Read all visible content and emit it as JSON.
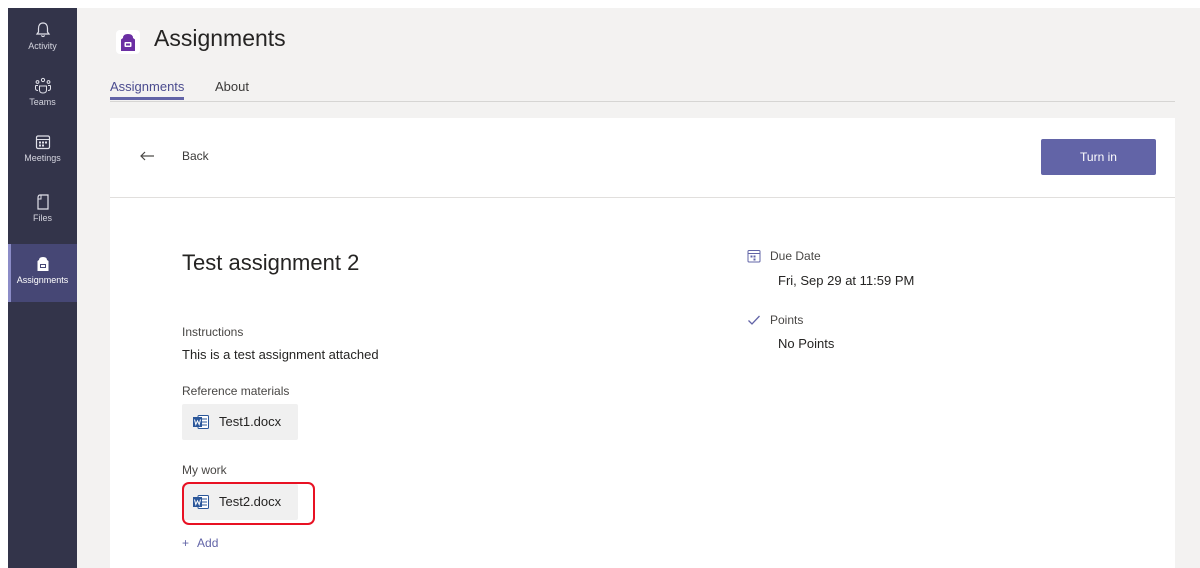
{
  "rail": {
    "items": [
      {
        "label": "Activity",
        "icon": "bell-icon"
      },
      {
        "label": "Teams",
        "icon": "teams-icon"
      },
      {
        "label": "Meetings",
        "icon": "calendar-icon"
      },
      {
        "label": "Files",
        "icon": "file-icon"
      },
      {
        "label": "Assignments",
        "icon": "assignments-icon"
      }
    ],
    "active_index": 4
  },
  "header": {
    "title": "Assignments",
    "tabs": [
      {
        "label": "Assignments",
        "active": true
      },
      {
        "label": "About",
        "active": false
      }
    ]
  },
  "toolbar": {
    "back_label": "Back",
    "turn_in_label": "Turn in"
  },
  "assignment": {
    "title": "Test assignment 2",
    "instructions_label": "Instructions",
    "instructions_text": "This is a test assignment attached",
    "reference_label": "Reference materials",
    "reference_files": [
      {
        "name": "Test1.docx",
        "icon": "word-icon"
      }
    ],
    "my_work_label": "My work",
    "my_work_files": [
      {
        "name": "Test2.docx",
        "icon": "word-icon"
      }
    ],
    "add_label": "Add",
    "add_symbol": "+"
  },
  "details": {
    "due_label": "Due Date",
    "due_value": "Fri, Sep 29 at 11:59 PM",
    "points_label": "Points",
    "points_value": "No Points"
  },
  "colors": {
    "rail_bg": "#33344a",
    "accent": "#6264a7",
    "highlight": "#e81123",
    "word_blue": "#2b579a"
  }
}
